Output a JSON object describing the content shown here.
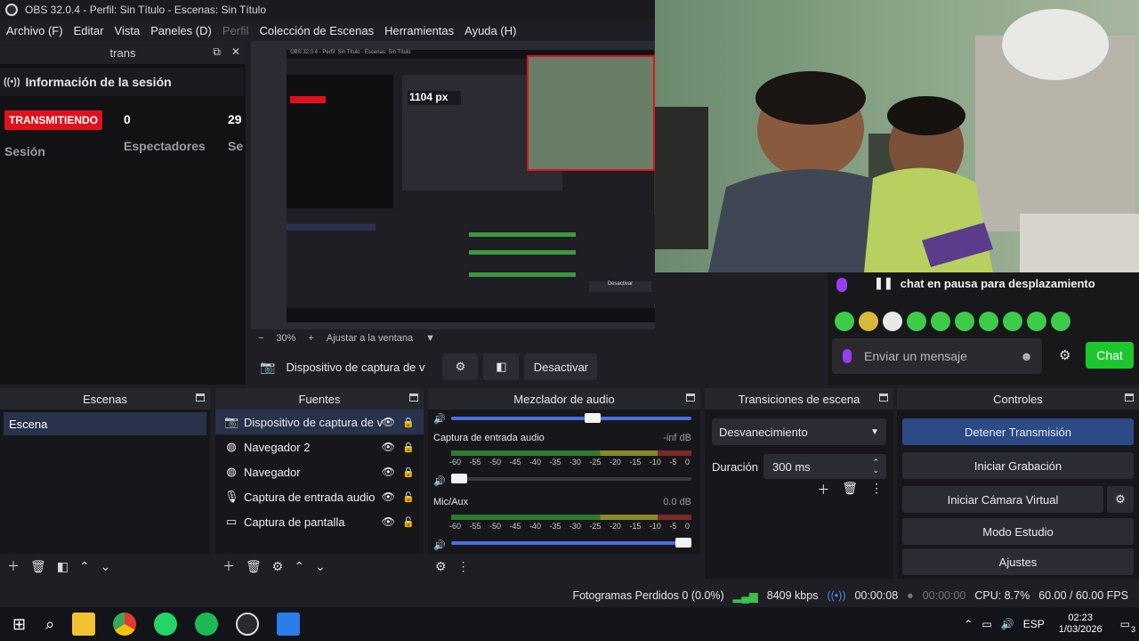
{
  "window": {
    "title": "OBS 32.0.4 - Perfil: Sin Título - Escenas: Sin Título"
  },
  "menu": [
    "Archivo (F)",
    "Editar",
    "Vista",
    "Paneles (D)",
    "Perfil",
    "Colección de Escenas",
    "Herramientas",
    "Ayuda (H)"
  ],
  "session": {
    "dock_title": "trans",
    "title": "Información de la sesión",
    "status": "TRANSMITIENDO",
    "status_label": "Sesión",
    "viewers_value": "0",
    "viewers_label": "Espectadores",
    "third_value": "29",
    "third_label": "Se"
  },
  "preview": {
    "zoom": "30%",
    "zoom_minus": "−",
    "zoom_plus": "+",
    "fit_label": "Ajustar a la ventana",
    "inner_size_label": "1104 px",
    "inner_title": "OBS 32.0.4 - Perfil: Sin Título - Escenas: Sin Título",
    "inner_deactivate": "Desactivar"
  },
  "source_toolbar": {
    "source_name": "Dispositivo de captura de v",
    "deactivate_label": "Desactivar"
  },
  "chat": {
    "pause_text": "chat en pausa para desplazamiento",
    "placeholder": "Enviar un mensaje",
    "chat_button": "Chat"
  },
  "docks": {
    "scenes": {
      "title": "Escenas",
      "items": [
        "Escena"
      ]
    },
    "sources": {
      "title": "Fuentes",
      "items": [
        {
          "label": "Dispositivo de captura de v",
          "icon": "camera-icon"
        },
        {
          "label": "Navegador 2",
          "icon": "globe-icon"
        },
        {
          "label": "Navegador",
          "icon": "globe-icon"
        },
        {
          "label": "Captura de entrada audio",
          "icon": "mic-icon"
        },
        {
          "label": "Captura de pantalla",
          "icon": "monitor-icon"
        }
      ]
    },
    "mixer": {
      "title": "Mezclador de audio",
      "channels": [
        {
          "name": "Captura de entrada audio",
          "level": "-inf dB",
          "volume": 0.06
        },
        {
          "name": "Mic/Aux",
          "level": "0.0 dB",
          "volume": 1.0
        }
      ],
      "ticks": [
        "-60",
        "-55",
        "-50",
        "-45",
        "-40",
        "-35",
        "-30",
        "-25",
        "-20",
        "-15",
        "-10",
        "-5",
        "0"
      ]
    },
    "transitions": {
      "title": "Transiciones de escena",
      "selected": "Desvanecimiento",
      "duration_label": "Duración",
      "duration_value": "300 ms"
    },
    "controls": {
      "title": "Controles",
      "buttons": [
        "Detener Transmisión",
        "Iniciar Grabación",
        "Iniciar Cámara Virtual",
        "Modo Estudio",
        "Ajustes"
      ]
    }
  },
  "status": {
    "dropped": "Fotogramas Perdidos 0 (0.0%)",
    "bitrate": "8409 kbps",
    "stream_time": "00:00:08",
    "rec_time": "00:00:00",
    "cpu": "CPU: 8.7%",
    "fps": "60.00 / 60.00 FPS"
  },
  "taskbar": {
    "lang": "ESP",
    "time": "02:23",
    "date": "1/03/2026",
    "notif_count": "3"
  },
  "colors": {
    "accent": "#28324a",
    "live": "#e0101c",
    "chat_green": "#1ec62e",
    "active_btn": "#2c4a86"
  }
}
